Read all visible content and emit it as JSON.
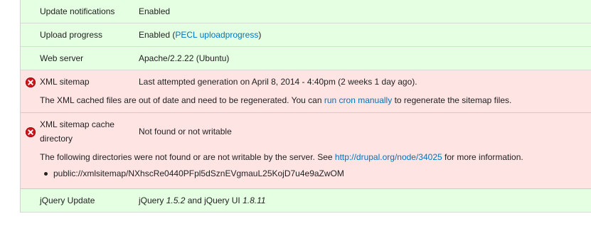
{
  "rows": [
    {
      "title": "Update notifications",
      "value": "Enabled"
    },
    {
      "title": "Upload progress",
      "value_prefix": "Enabled (",
      "value_link": "PECL uploadprogress",
      "value_suffix": ")"
    },
    {
      "title": "Web server",
      "value": "Apache/2.2.22 (Ubuntu)"
    },
    {
      "title": "XML sitemap",
      "value": "Last attempted generation on April 8, 2014 - 4:40pm (2 weeks 1 day ago).",
      "desc_prefix": "The XML cached files are out of date and need to be regenerated. You can ",
      "desc_link": "run cron manually",
      "desc_suffix": " to regenerate the sitemap files."
    },
    {
      "title": "XML sitemap cache directory",
      "value": "Not found or not writable",
      "desc_prefix": "The following directories were not found or are not writable by the server. See ",
      "desc_link": "http://drupal.org/node/34025",
      "desc_suffix": " for more information.",
      "items": [
        "public://xmlsitemap/NXhscRe0440PFpl5dSznEVgmauL25KojD7u4e9aZwOM"
      ]
    },
    {
      "title": "jQuery Update",
      "value_part1": "jQuery ",
      "value_ver1": "1.5.2",
      "value_part2": " and jQuery UI ",
      "value_ver2": "1.8.11"
    }
  ],
  "colors": {
    "ok_row": "#e5ffe2",
    "error_row": "#ffe4e4",
    "link": "#0074bd",
    "error_icon": "#d0151b"
  },
  "icons": {
    "error": "error-x-icon"
  }
}
